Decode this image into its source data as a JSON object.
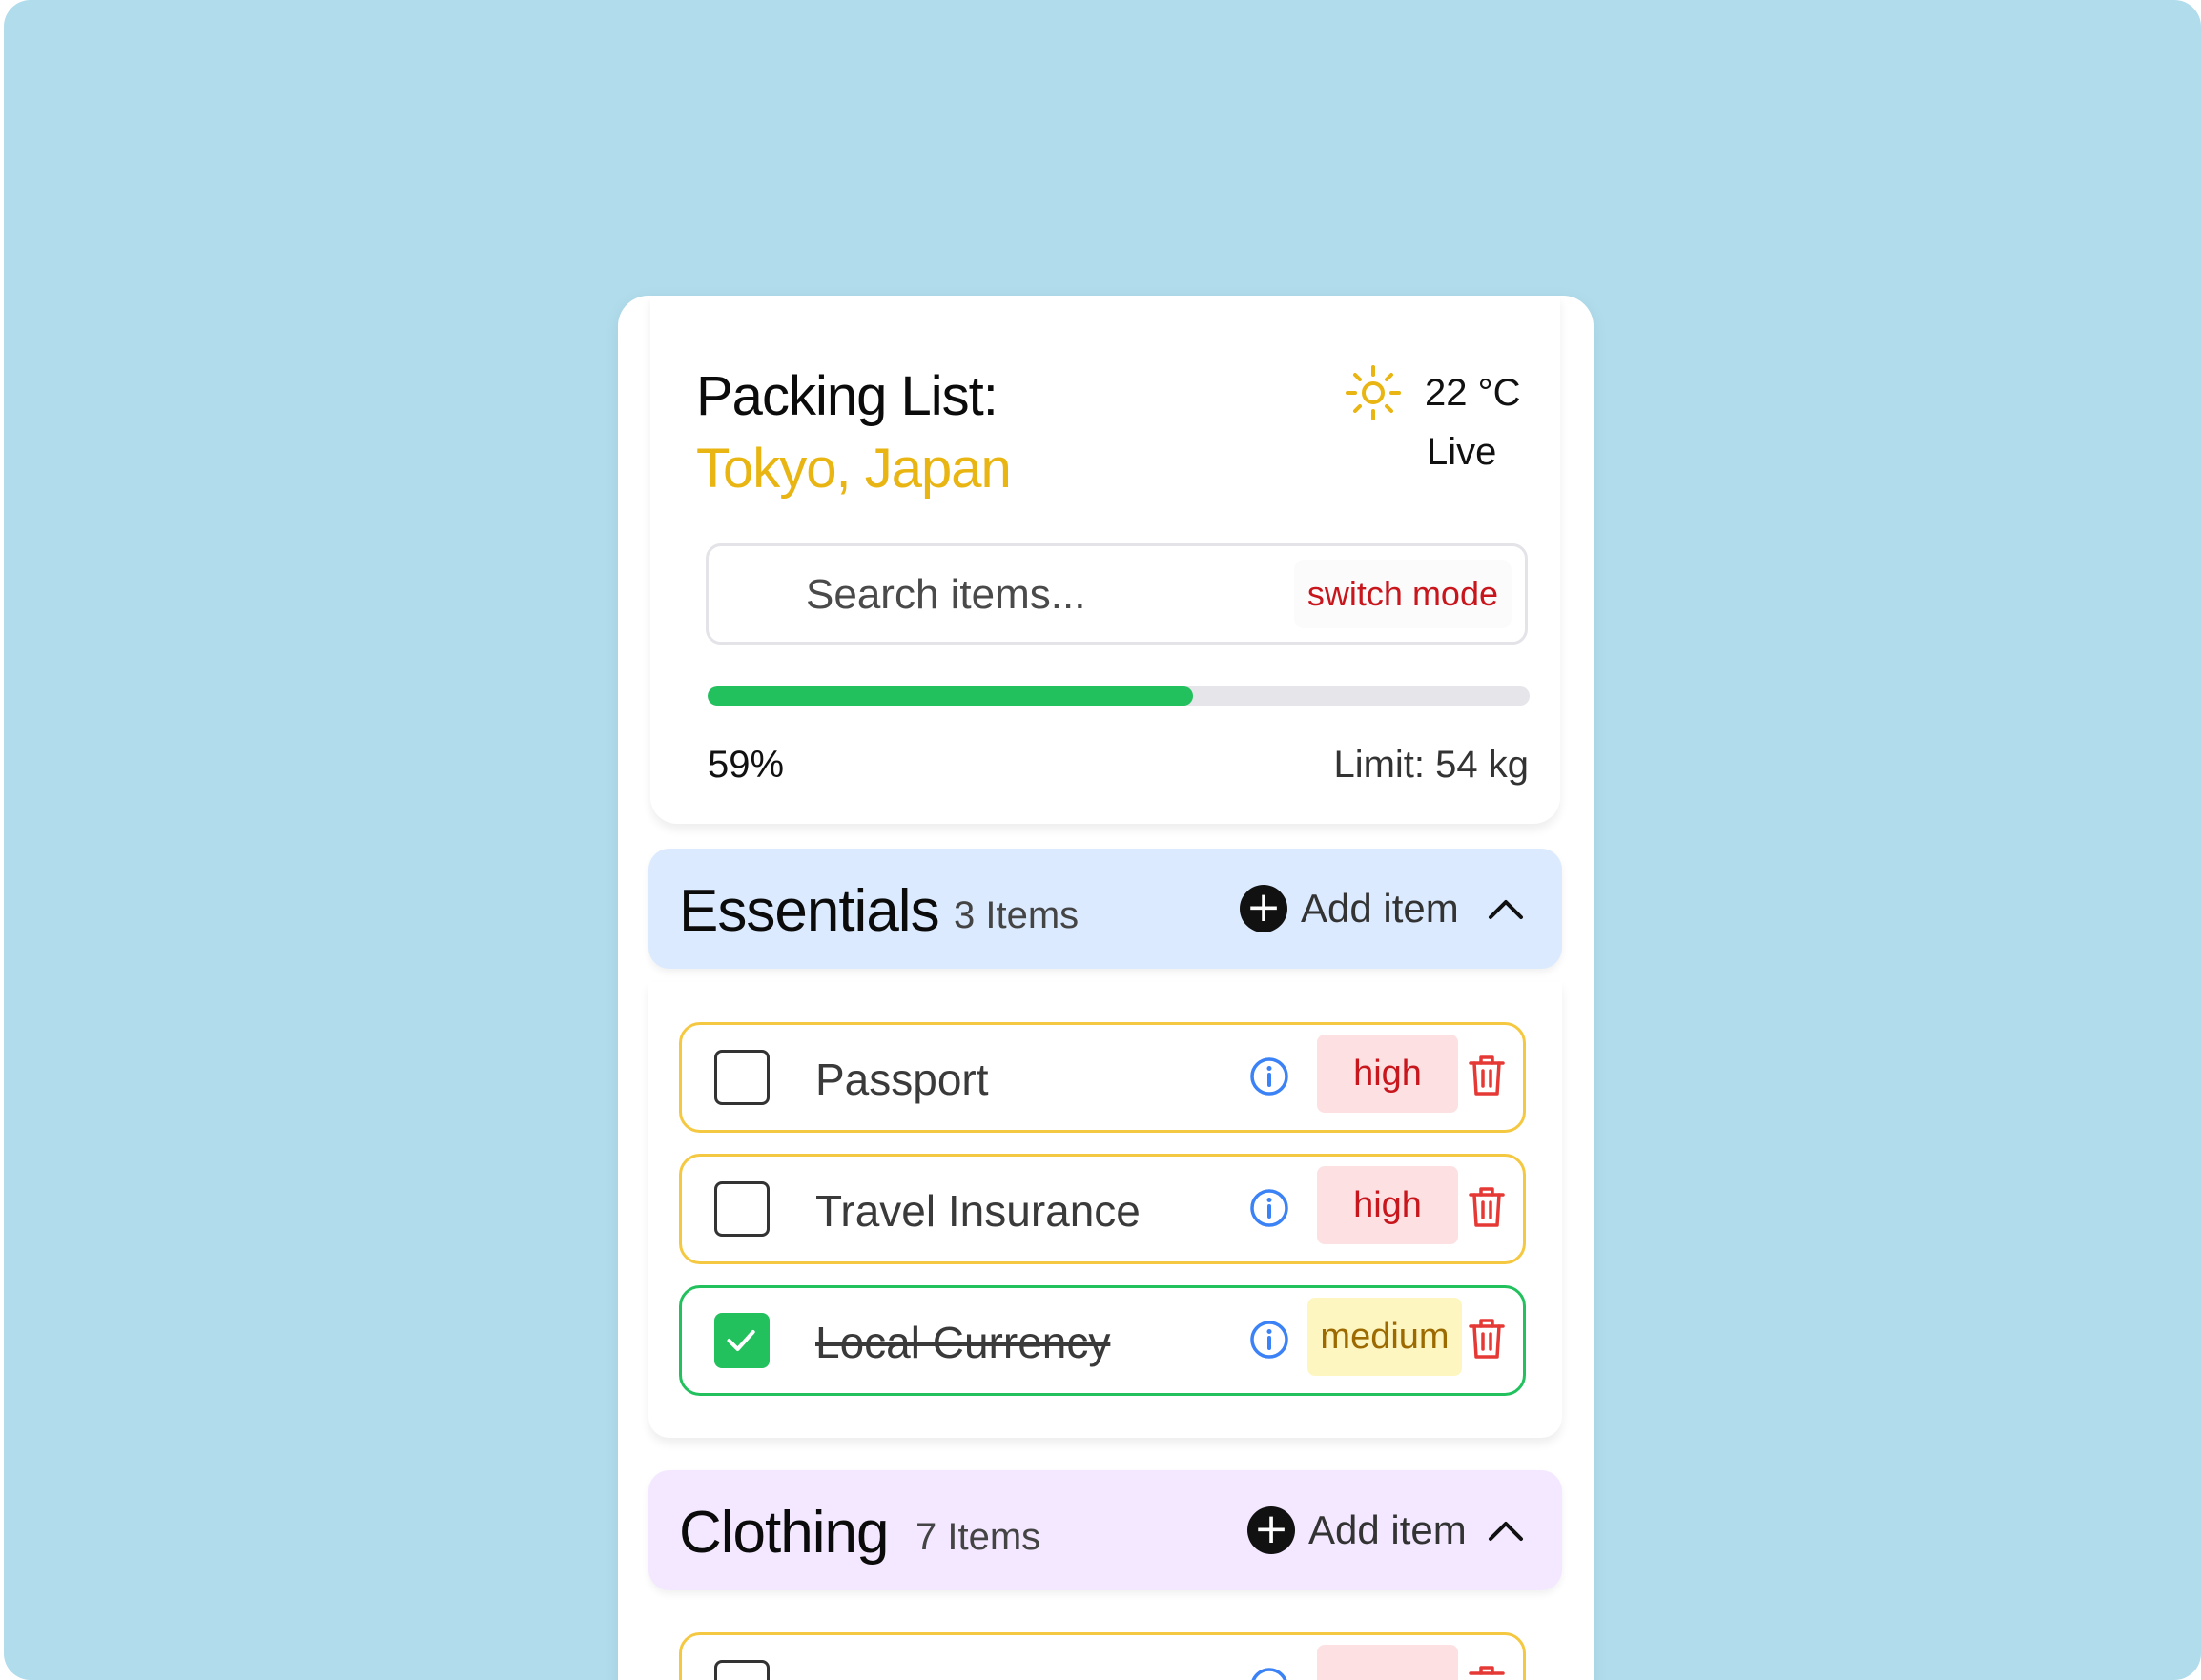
{
  "header": {
    "title": "Packing List:",
    "destination": "Tokyo, Japan",
    "weather_icon": "sun-icon",
    "temperature": "22 °C",
    "live_label": "Live"
  },
  "search": {
    "placeholder": "Search items...",
    "switch_mode_label": "switch mode"
  },
  "progress": {
    "percent": 59,
    "percent_label": "59%",
    "limit_label": "Limit: 54 kg"
  },
  "categories": [
    {
      "name": "Essentials",
      "count_label": "3 Items",
      "add_label": "Add item",
      "color": "#dbeafe",
      "items": [
        {
          "label": "Passport",
          "checked": false,
          "priority": "high"
        },
        {
          "label": "Travel Insurance",
          "checked": false,
          "priority": "high"
        },
        {
          "label": "Local Currency",
          "checked": true,
          "priority": "medium"
        }
      ]
    },
    {
      "name": "Clothing",
      "count_label": "7 Items",
      "add_label": "Add item",
      "color": "#f3e8ff"
    }
  ],
  "colors": {
    "background": "#b0dcec",
    "accent_yellow": "#e9b512",
    "progress_green": "#22c15e",
    "danger_red": "#c8161d",
    "info_blue": "#3b82f6"
  }
}
